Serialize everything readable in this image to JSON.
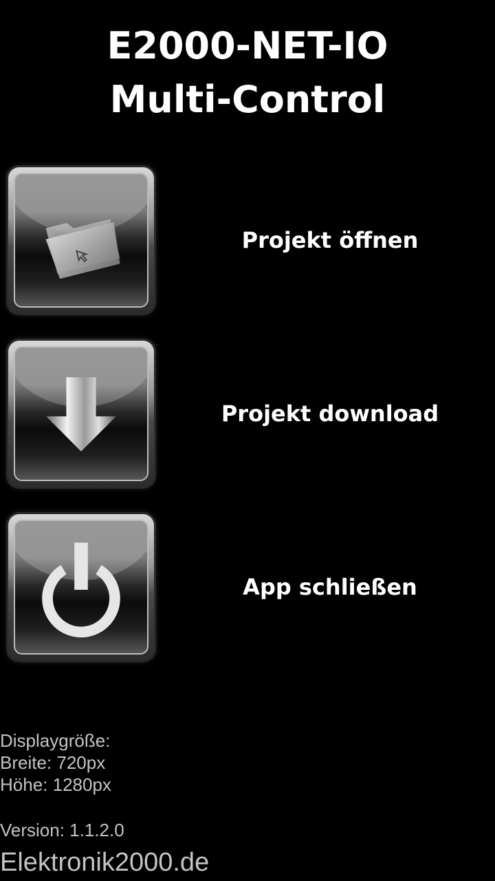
{
  "header": {
    "title_line1": "E2000-NET-IO",
    "title_line2": "Multi-Control"
  },
  "menu": [
    {
      "label": "Projekt öffnen",
      "icon": "folder-icon"
    },
    {
      "label": "Projekt download",
      "icon": "download-arrow-icon"
    },
    {
      "label": "App schließen",
      "icon": "power-icon"
    }
  ],
  "info": {
    "display_size_label": "Displaygröße:",
    "width_line": "Breite: 720px",
    "height_line": "Höhe: 1280px",
    "version_line": "Version: 1.1.2.0",
    "brand": "Elektronik2000.de"
  },
  "colors": {
    "background": "#000000",
    "text": "#ffffff",
    "info_text": "#c4c4c4"
  }
}
